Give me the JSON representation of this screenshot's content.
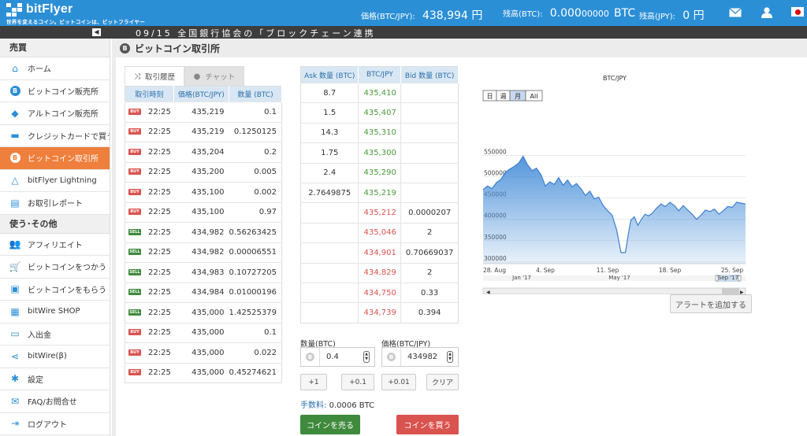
{
  "header": {
    "brand": "bitFlyer",
    "tagline": "世界を変えるコイン。ビットコインは、ビットフライヤー",
    "price_label": "価格(BTC/JPY):",
    "price_value": "438,994 円",
    "btc_label": "残高(BTC):",
    "btc_value": "0.000",
    "btc_value_small": "00000",
    "btc_unit": "BTC",
    "jpy_label": "残高(JPY):",
    "jpy_value": "0 円",
    "icons": [
      "mail-icon",
      "user-icon",
      "japan-flag-icon"
    ],
    "accent": "#2b8fd6"
  },
  "news": {
    "text": "09/15 全国銀行協会の「ブロックチェーン連携"
  },
  "sidebar": {
    "section1": "売買",
    "items1": [
      {
        "label": "ホーム",
        "icon": "home-icon"
      },
      {
        "label": "ビットコイン販売所",
        "icon": "bitcoin-icon"
      },
      {
        "label": "アルトコイン販売所",
        "icon": "ether-icon"
      },
      {
        "label": "クレジットカードで買う",
        "icon": "credit-card-icon"
      },
      {
        "label": "ビットコイン取引所",
        "icon": "bitcoin-icon",
        "active": true
      },
      {
        "label": "bitFlyer Lightning",
        "icon": "lightning-icon"
      },
      {
        "label": "お取引レポート",
        "icon": "report-icon"
      }
    ],
    "section2": "使う･その他",
    "items2": [
      {
        "label": "アフィリエイト",
        "icon": "people-icon"
      },
      {
        "label": "ビットコインをつかう",
        "icon": "cart-icon"
      },
      {
        "label": "ビットコインをもらう",
        "icon": "gift-icon"
      },
      {
        "label": "bitWire SHOP",
        "icon": "shop-icon"
      },
      {
        "label": "入出金",
        "icon": "wallet-icon"
      },
      {
        "label": "bitWire(β)",
        "icon": "share-icon"
      },
      {
        "label": "設定",
        "icon": "gear-icon"
      },
      {
        "label": "FAQ/お問合せ",
        "icon": "mail-icon"
      },
      {
        "label": "ログアウト",
        "icon": "logout-icon"
      }
    ],
    "active_color": "#ef7f3c"
  },
  "page": {
    "title": "ビットコイン取引所"
  },
  "tabs": {
    "history": "取引履歴",
    "chat": "チャット"
  },
  "history": {
    "headers": [
      "取引時刻",
      "価格(BTC/JPY)",
      "数量 (BTC)"
    ],
    "rows": [
      {
        "side": "BUY",
        "time": "22:25",
        "price": "435,219",
        "qty": "0.1"
      },
      {
        "side": "BUY",
        "time": "22:25",
        "price": "435,219",
        "qty": "0.1250125"
      },
      {
        "side": "BUY",
        "time": "22:25",
        "price": "435,204",
        "qty": "0.2"
      },
      {
        "side": "BUY",
        "time": "22:25",
        "price": "435,200",
        "qty": "0.005"
      },
      {
        "side": "BUY",
        "time": "22:25",
        "price": "435,100",
        "qty": "0.002"
      },
      {
        "side": "BUY",
        "time": "22:25",
        "price": "435,100",
        "qty": "0.97"
      },
      {
        "side": "SELL",
        "time": "22:25",
        "price": "434,982",
        "qty": "0.56263425"
      },
      {
        "side": "SELL",
        "time": "22:25",
        "price": "434,982",
        "qty": "0.00006551"
      },
      {
        "side": "SELL",
        "time": "22:25",
        "price": "434,983",
        "qty": "0.10727205"
      },
      {
        "side": "SELL",
        "time": "22:25",
        "price": "434,984",
        "qty": "0.01000196"
      },
      {
        "side": "SELL",
        "time": "22:25",
        "price": "435,000",
        "qty": "1.42525379"
      },
      {
        "side": "BUY",
        "time": "22:25",
        "price": "435,000",
        "qty": "0.1"
      },
      {
        "side": "BUY",
        "time": "22:25",
        "price": "435,000",
        "qty": "0.022"
      },
      {
        "side": "BUY",
        "time": "22:25",
        "price": "435,000",
        "qty": "0.45274621"
      }
    ]
  },
  "book": {
    "headers": [
      "Ask 数量 (BTC)",
      "BTC/JPY",
      "Bid 数量 (BTC)"
    ],
    "asks": [
      {
        "qty": "8.7",
        "price": "435,410"
      },
      {
        "qty": "1.5",
        "price": "435,407"
      },
      {
        "qty": "14.3",
        "price": "435,310"
      },
      {
        "qty": "1.75",
        "price": "435,300"
      },
      {
        "qty": "2.4",
        "price": "435,290"
      },
      {
        "qty": "2.7649875",
        "price": "435,219"
      }
    ],
    "bids": [
      {
        "price": "435,212",
        "qty": "0.0000207"
      },
      {
        "price": "435,046",
        "qty": "2"
      },
      {
        "price": "434,901",
        "qty": "0.70669037"
      },
      {
        "price": "434,829",
        "qty": "2"
      },
      {
        "price": "434,750",
        "qty": "0.33"
      },
      {
        "price": "434,739",
        "qty": "0.394"
      }
    ]
  },
  "order": {
    "qty_label": "数量(BTC)",
    "qty_value": "0.4",
    "price_label": "価格(BTC/JPY)",
    "price_value": "434982",
    "quick": [
      "+1",
      "+0.1",
      "+0.01",
      "クリア"
    ],
    "fee_label": "手数料:",
    "fee_value": "0.0006 BTC",
    "sell": "コインを売る",
    "buy": "コインを買う"
  },
  "chart_data": {
    "type": "area",
    "title": "BTC/JPY",
    "ranges": [
      "日",
      "週",
      "月",
      "All"
    ],
    "active_range": "月",
    "y_ticks": [
      300000,
      350000,
      400000,
      450000,
      500000,
      550000
    ],
    "ylim": [
      296000,
      560000
    ],
    "x_ticks": [
      {
        "day": 0,
        "label": "28. Aug"
      },
      {
        "day": 7,
        "label": "4. Sep"
      },
      {
        "day": 14,
        "label": "11. Sep"
      },
      {
        "day": 21,
        "label": "18. Sep"
      },
      {
        "day": 28,
        "label": "25. Sep"
      }
    ],
    "xlim": [
      0,
      29.5
    ],
    "navigator_labels": [
      "Jan '17",
      "May '17",
      "Sep '17"
    ],
    "x": [
      0,
      0.5,
      1,
      1.5,
      2,
      2.5,
      3,
      3.5,
      4,
      4.5,
      5,
      5.5,
      6,
      6.5,
      7,
      7.5,
      8,
      8.5,
      9,
      9.5,
      10,
      10.5,
      11,
      11.5,
      12,
      12.5,
      13,
      13.5,
      14,
      14.5,
      15,
      15.5,
      16,
      16.3,
      16.6,
      17,
      17.4,
      17.8,
      18.2,
      18.6,
      19,
      19.5,
      20,
      20.5,
      21,
      21.5,
      22,
      22.5,
      23,
      23.5,
      24,
      24.5,
      25,
      25.5,
      26,
      26.5,
      27,
      27.5,
      28,
      28.5,
      29,
      29.5
    ],
    "values": [
      470000,
      478000,
      472000,
      486000,
      494000,
      510000,
      518000,
      524000,
      532000,
      548000,
      528000,
      514000,
      520000,
      505000,
      478000,
      488000,
      482000,
      498000,
      480000,
      492000,
      476000,
      484000,
      472000,
      456000,
      466000,
      448000,
      452000,
      432000,
      420000,
      410000,
      376000,
      322000,
      322000,
      362000,
      398000,
      406000,
      386000,
      400000,
      412000,
      408000,
      414000,
      426000,
      436000,
      430000,
      440000,
      432000,
      420000,
      432000,
      422000,
      412000,
      400000,
      410000,
      422000,
      418000,
      424000,
      412000,
      420000,
      430000,
      428000,
      440000,
      438000,
      436000
    ]
  }
}
